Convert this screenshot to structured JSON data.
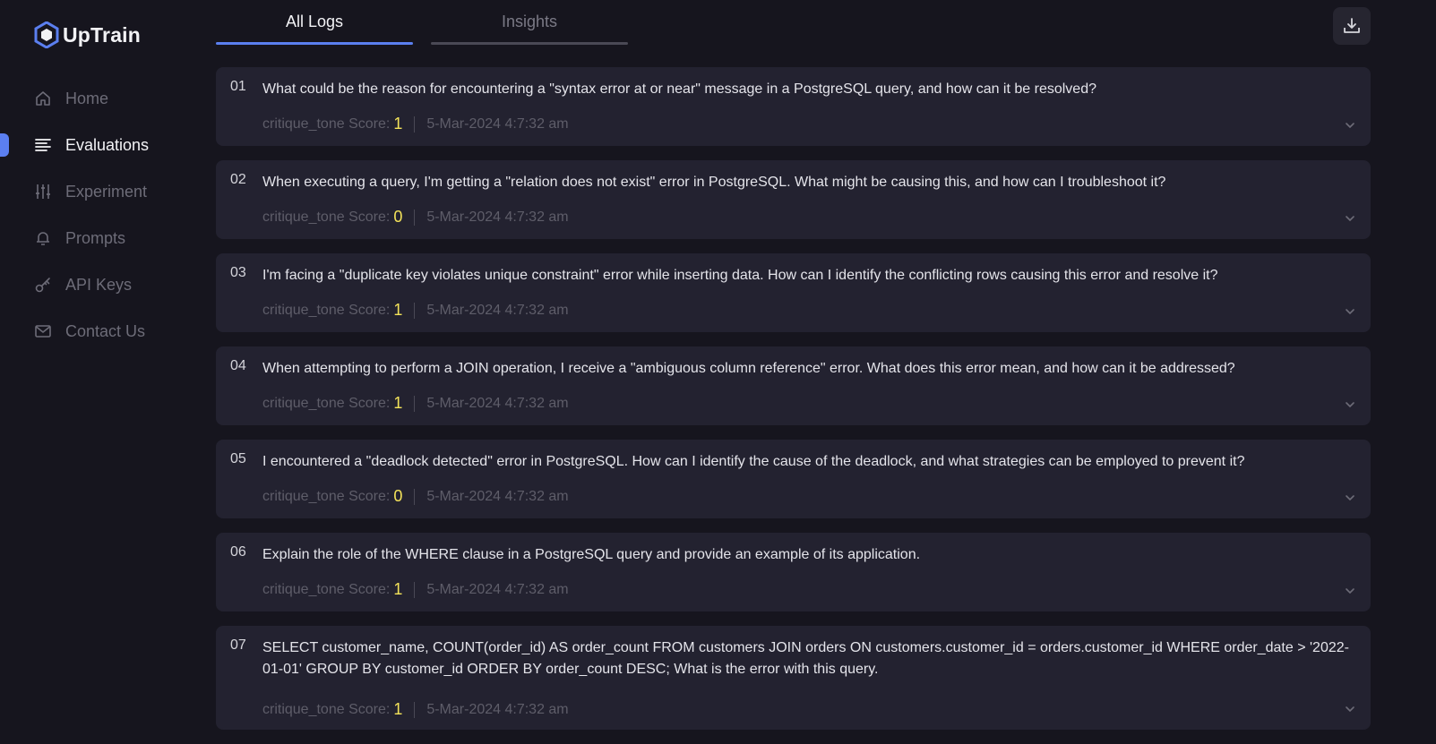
{
  "app": {
    "name": "UpTrain"
  },
  "sidebar": {
    "items": [
      {
        "label": "Home",
        "icon": "home-icon",
        "active": false
      },
      {
        "label": "Evaluations",
        "icon": "list-icon",
        "active": true
      },
      {
        "label": "Experiment",
        "icon": "sliders-icon",
        "active": false
      },
      {
        "label": "Prompts",
        "icon": "bell-icon",
        "active": false
      },
      {
        "label": "API Keys",
        "icon": "key-icon",
        "active": false
      },
      {
        "label": "Contact Us",
        "icon": "mail-icon",
        "active": false
      }
    ]
  },
  "tabs": [
    {
      "label": "All Logs",
      "active": true
    },
    {
      "label": "Insights",
      "active": false
    }
  ],
  "download": {
    "icon": "download-icon"
  },
  "logs": [
    {
      "num": "01",
      "question": "What could be the reason for encountering a \"syntax error at or near\" message in a PostgreSQL query, and how can it be resolved?",
      "score_label": "critique_tone Score:",
      "score": "1",
      "timestamp": "5-Mar-2024 4:7:32 am"
    },
    {
      "num": "02",
      "question": "When executing a query, I'm getting a \"relation does not exist\" error in PostgreSQL. What might be causing this, and how can I troubleshoot it?",
      "score_label": "critique_tone Score:",
      "score": "0",
      "timestamp": "5-Mar-2024 4:7:32 am"
    },
    {
      "num": "03",
      "question": "I'm facing a \"duplicate key violates unique constraint\" error while inserting data. How can I identify the conflicting rows causing this error and resolve it?",
      "score_label": "critique_tone Score:",
      "score": "1",
      "timestamp": "5-Mar-2024 4:7:32 am"
    },
    {
      "num": "04",
      "question": "When attempting to perform a JOIN operation, I receive a \"ambiguous column reference\" error. What does this error mean, and how can it be addressed?",
      "score_label": "critique_tone Score:",
      "score": "1",
      "timestamp": "5-Mar-2024 4:7:32 am"
    },
    {
      "num": "05",
      "question": "I encountered a \"deadlock detected\" error in PostgreSQL. How can I identify the cause of the deadlock, and what strategies can be employed to prevent it?",
      "score_label": "critique_tone Score:",
      "score": "0",
      "timestamp": "5-Mar-2024 4:7:32 am"
    },
    {
      "num": "06",
      "question": "Explain the role of the WHERE clause in a PostgreSQL query and provide an example of its application.",
      "score_label": "critique_tone Score:",
      "score": "1",
      "timestamp": "5-Mar-2024 4:7:32 am"
    },
    {
      "num": "07",
      "question": "SELECT customer_name, COUNT(order_id) AS order_count FROM customers JOIN orders ON customers.customer_id = orders.customer_id WHERE order_date > '2022-01-01' GROUP BY customer_id ORDER BY order_count DESC; What is the error with this query.",
      "score_label": "critique_tone Score:",
      "score": "1",
      "timestamp": "5-Mar-2024 4:7:32 am"
    }
  ],
  "colors": {
    "accent": "#5b7ff0",
    "score": "#f4e35a",
    "card": "#232230",
    "background": "#16151e"
  }
}
